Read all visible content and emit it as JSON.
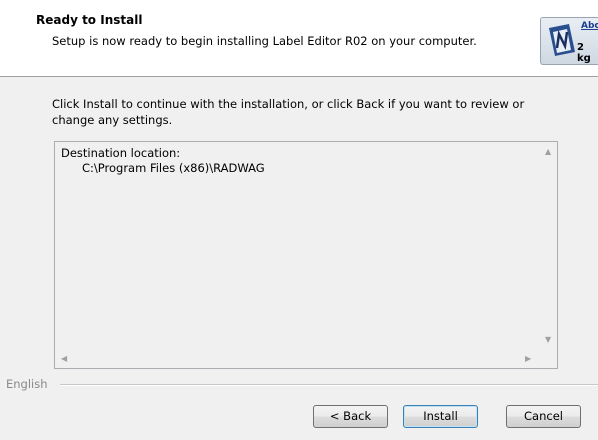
{
  "header": {
    "title": "Ready to Install",
    "subtitle": "Setup is now ready to begin installing Label Editor R02 on your computer.",
    "logo": {
      "top_text": "Abc",
      "bottom_text": "2 kg",
      "icon": "label-editor-logo-icon"
    }
  },
  "main": {
    "intro": "Click Install to continue with the installation, or click Back if you want to review or change any settings.",
    "memo": {
      "label": "Destination location:",
      "value": "C:\\Program Files (x86)\\RADWAG"
    }
  },
  "footer": {
    "language": "English",
    "back_label": "< Back",
    "install_label": "Install",
    "cancel_label": "Cancel"
  },
  "colors": {
    "header_bg": "#ffffff",
    "dialog_bg": "#f0f0f0",
    "default_button_border": "#3c7fb1"
  }
}
